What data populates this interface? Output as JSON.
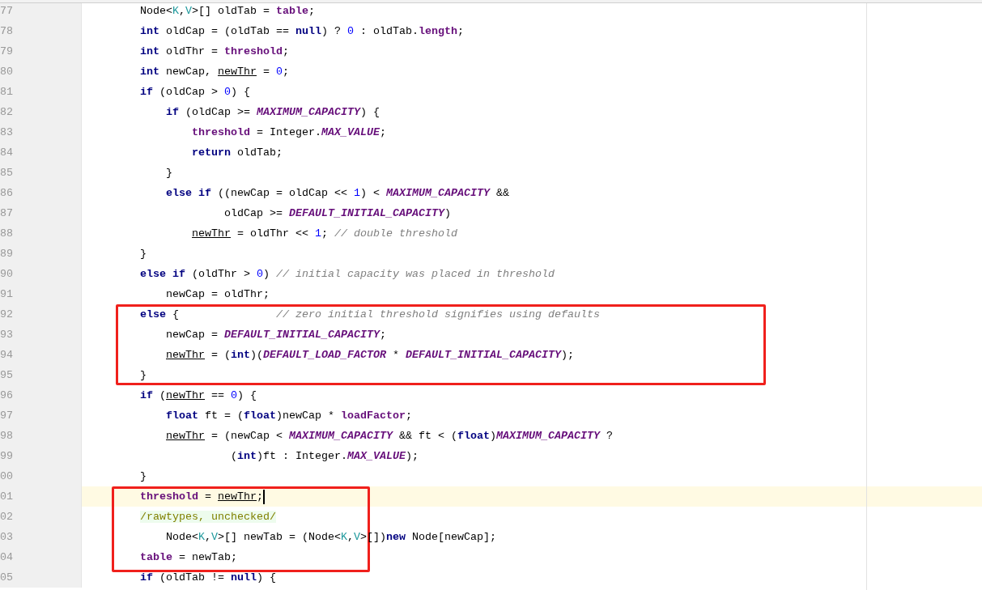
{
  "editor": {
    "lines": [
      {
        "number": "77",
        "current": false,
        "in_red_box": false,
        "tokens": [
          {
            "kind": "plain",
            "text": "Node<"
          },
          {
            "kind": "typeparam",
            "text": "K"
          },
          {
            "kind": "plain",
            "text": ","
          },
          {
            "kind": "typeparam",
            "text": "V"
          },
          {
            "kind": "plain",
            "text": ">[] oldTab = "
          },
          {
            "kind": "field",
            "text": "table"
          },
          {
            "kind": "plain",
            "text": ";"
          }
        ]
      },
      {
        "number": "78",
        "current": false,
        "in_red_box": false,
        "tokens": [
          {
            "kind": "keyword",
            "text": "int"
          },
          {
            "kind": "plain",
            "text": " oldCap = (oldTab == "
          },
          {
            "kind": "keyword",
            "text": "null"
          },
          {
            "kind": "plain",
            "text": ") ? "
          },
          {
            "kind": "number",
            "text": "0"
          },
          {
            "kind": "plain",
            "text": " : oldTab."
          },
          {
            "kind": "field",
            "text": "length"
          },
          {
            "kind": "plain",
            "text": ";"
          }
        ]
      },
      {
        "number": "79",
        "current": false,
        "in_red_box": false,
        "tokens": [
          {
            "kind": "keyword",
            "text": "int"
          },
          {
            "kind": "plain",
            "text": " oldThr = "
          },
          {
            "kind": "field",
            "text": "threshold"
          },
          {
            "kind": "plain",
            "text": ";"
          }
        ]
      },
      {
        "number": "80",
        "current": false,
        "in_red_box": false,
        "tokens": [
          {
            "kind": "keyword",
            "text": "int"
          },
          {
            "kind": "plain",
            "text": " newCap, "
          },
          {
            "kind": "reassigned",
            "text": "newThr"
          },
          {
            "kind": "plain",
            "text": " = "
          },
          {
            "kind": "number",
            "text": "0"
          },
          {
            "kind": "plain",
            "text": ";"
          }
        ]
      },
      {
        "number": "81",
        "current": false,
        "in_red_box": false,
        "tokens": [
          {
            "kind": "keyword",
            "text": "if"
          },
          {
            "kind": "plain",
            "text": " (oldCap > "
          },
          {
            "kind": "number",
            "text": "0"
          },
          {
            "kind": "plain",
            "text": ") {"
          }
        ]
      },
      {
        "number": "82",
        "current": false,
        "in_red_box": false,
        "tokens": [
          {
            "kind": "keyword",
            "text": "    if"
          },
          {
            "kind": "plain",
            "text": " (oldCap >= "
          },
          {
            "kind": "constant",
            "text": "MAXIMUM_CAPACITY"
          },
          {
            "kind": "plain",
            "text": ") {"
          }
        ]
      },
      {
        "number": "83",
        "current": false,
        "in_red_box": false,
        "tokens": [
          {
            "kind": "field",
            "text": "        threshold"
          },
          {
            "kind": "plain",
            "text": " = Integer."
          },
          {
            "kind": "constant",
            "text": "MAX_VALUE"
          },
          {
            "kind": "plain",
            "text": ";"
          }
        ]
      },
      {
        "number": "84",
        "current": false,
        "in_red_box": false,
        "tokens": [
          {
            "kind": "keyword",
            "text": "        return"
          },
          {
            "kind": "plain",
            "text": " oldTab;"
          }
        ]
      },
      {
        "number": "85",
        "current": false,
        "in_red_box": false,
        "tokens": [
          {
            "kind": "plain",
            "text": "    }"
          }
        ]
      },
      {
        "number": "86",
        "current": false,
        "in_red_box": false,
        "tokens": [
          {
            "kind": "keyword",
            "text": "    else if"
          },
          {
            "kind": "plain",
            "text": " ((newCap = oldCap << "
          },
          {
            "kind": "number",
            "text": "1"
          },
          {
            "kind": "plain",
            "text": ") < "
          },
          {
            "kind": "constant",
            "text": "MAXIMUM_CAPACITY"
          },
          {
            "kind": "plain",
            "text": " &&"
          }
        ]
      },
      {
        "number": "87",
        "current": false,
        "in_red_box": false,
        "tokens": [
          {
            "kind": "plain",
            "text": "             oldCap >= "
          },
          {
            "kind": "constant",
            "text": "DEFAULT_INITIAL_CAPACITY"
          },
          {
            "kind": "plain",
            "text": ")"
          }
        ]
      },
      {
        "number": "88",
        "current": false,
        "in_red_box": false,
        "tokens": [
          {
            "kind": "reassigned",
            "text": "        newThr"
          },
          {
            "kind": "plain",
            "text": " = oldThr << "
          },
          {
            "kind": "number",
            "text": "1"
          },
          {
            "kind": "plain",
            "text": "; "
          },
          {
            "kind": "comment",
            "text": "// double threshold"
          }
        ]
      },
      {
        "number": "89",
        "current": false,
        "in_red_box": false,
        "tokens": [
          {
            "kind": "plain",
            "text": "}"
          }
        ]
      },
      {
        "number": "90",
        "current": false,
        "in_red_box": false,
        "tokens": [
          {
            "kind": "keyword",
            "text": "else if"
          },
          {
            "kind": "plain",
            "text": " (oldThr > "
          },
          {
            "kind": "number",
            "text": "0"
          },
          {
            "kind": "plain",
            "text": ") "
          },
          {
            "kind": "comment",
            "text": "// initial capacity was placed in threshold"
          }
        ]
      },
      {
        "number": "91",
        "current": false,
        "in_red_box": false,
        "tokens": [
          {
            "kind": "plain",
            "text": "    newCap = oldThr;"
          }
        ]
      },
      {
        "number": "92",
        "current": false,
        "in_red_box": true,
        "tokens": [
          {
            "kind": "keyword",
            "text": "else"
          },
          {
            "kind": "plain",
            "text": " {"
          },
          {
            "kind": "comment",
            "text": "               // zero initial threshold signifies using defaults"
          }
        ]
      },
      {
        "number": "93",
        "current": false,
        "in_red_box": true,
        "tokens": [
          {
            "kind": "plain",
            "text": "    newCap = "
          },
          {
            "kind": "constant",
            "text": "DEFAULT_INITIAL_CAPACITY"
          },
          {
            "kind": "plain",
            "text": ";"
          }
        ]
      },
      {
        "number": "94",
        "current": false,
        "in_red_box": true,
        "tokens": [
          {
            "kind": "reassigned",
            "text": "    newThr"
          },
          {
            "kind": "plain",
            "text": " = ("
          },
          {
            "kind": "keyword",
            "text": "int"
          },
          {
            "kind": "plain",
            "text": ")("
          },
          {
            "kind": "constant",
            "text": "DEFAULT_LOAD_FACTOR"
          },
          {
            "kind": "plain",
            "text": " * "
          },
          {
            "kind": "constant",
            "text": "DEFAULT_INITIAL_CAPACITY"
          },
          {
            "kind": "plain",
            "text": ");"
          }
        ]
      },
      {
        "number": "95",
        "current": false,
        "in_red_box": true,
        "tokens": [
          {
            "kind": "plain",
            "text": "}"
          }
        ]
      },
      {
        "number": "96",
        "current": false,
        "in_red_box": false,
        "tokens": [
          {
            "kind": "keyword",
            "text": "if"
          },
          {
            "kind": "plain",
            "text": " ("
          },
          {
            "kind": "reassigned",
            "text": "newThr"
          },
          {
            "kind": "plain",
            "text": " == "
          },
          {
            "kind": "number",
            "text": "0"
          },
          {
            "kind": "plain",
            "text": ") {"
          }
        ]
      },
      {
        "number": "97",
        "current": false,
        "in_red_box": false,
        "tokens": [
          {
            "kind": "keyword",
            "text": "    float"
          },
          {
            "kind": "plain",
            "text": " ft = ("
          },
          {
            "kind": "keyword",
            "text": "float"
          },
          {
            "kind": "plain",
            "text": ")newCap * "
          },
          {
            "kind": "field",
            "text": "loadFactor"
          },
          {
            "kind": "plain",
            "text": ";"
          }
        ]
      },
      {
        "number": "98",
        "current": false,
        "in_red_box": false,
        "tokens": [
          {
            "kind": "reassigned",
            "text": "    newThr"
          },
          {
            "kind": "plain",
            "text": " = (newCap < "
          },
          {
            "kind": "constant",
            "text": "MAXIMUM_CAPACITY"
          },
          {
            "kind": "plain",
            "text": " && ft < ("
          },
          {
            "kind": "keyword",
            "text": "float"
          },
          {
            "kind": "plain",
            "text": ")"
          },
          {
            "kind": "constant",
            "text": "MAXIMUM_CAPACITY"
          },
          {
            "kind": "plain",
            "text": " ?"
          }
        ]
      },
      {
        "number": "99",
        "current": false,
        "in_red_box": false,
        "tokens": [
          {
            "kind": "plain",
            "text": "              ("
          },
          {
            "kind": "keyword",
            "text": "int"
          },
          {
            "kind": "plain",
            "text": ")ft : Integer."
          },
          {
            "kind": "constant",
            "text": "MAX_VALUE"
          },
          {
            "kind": "plain",
            "text": ");"
          }
        ]
      },
      {
        "number": "00",
        "current": false,
        "in_red_box": false,
        "tokens": [
          {
            "kind": "plain",
            "text": "}"
          }
        ]
      },
      {
        "number": "01",
        "current": true,
        "in_red_box": true,
        "tokens": [
          {
            "kind": "field",
            "text": "threshold"
          },
          {
            "kind": "plain",
            "text": " = "
          },
          {
            "kind": "reassigned",
            "text": "newThr"
          },
          {
            "kind": "plain",
            "text": ";"
          }
        ]
      },
      {
        "number": "02",
        "current": false,
        "in_red_box": true,
        "tokens": [
          {
            "kind": "annotation",
            "text": "/rawtypes, unchecked/"
          }
        ]
      },
      {
        "number": "03",
        "current": false,
        "in_red_box": true,
        "tokens": [
          {
            "kind": "plain",
            "text": "    Node<"
          },
          {
            "kind": "typeparam",
            "text": "K"
          },
          {
            "kind": "plain",
            "text": ","
          },
          {
            "kind": "typeparam",
            "text": "V"
          },
          {
            "kind": "plain",
            "text": ">[] newTab = (Node<"
          },
          {
            "kind": "typeparam",
            "text": "K"
          },
          {
            "kind": "plain",
            "text": ","
          },
          {
            "kind": "typeparam",
            "text": "V"
          },
          {
            "kind": "plain",
            "text": ">[])"
          },
          {
            "kind": "keyword",
            "text": "new"
          },
          {
            "kind": "plain",
            "text": " Node[newCap];"
          }
        ]
      },
      {
        "number": "04",
        "current": false,
        "in_red_box": true,
        "tokens": [
          {
            "kind": "field",
            "text": "table"
          },
          {
            "kind": "plain",
            "text": " = newTab;"
          }
        ]
      },
      {
        "number": "05",
        "current": false,
        "in_red_box": false,
        "tokens": [
          {
            "kind": "keyword",
            "text": "if"
          },
          {
            "kind": "plain",
            "text": " (oldTab != "
          },
          {
            "kind": "keyword",
            "text": "null"
          },
          {
            "kind": "plain",
            "text": ") {"
          }
        ]
      }
    ]
  }
}
